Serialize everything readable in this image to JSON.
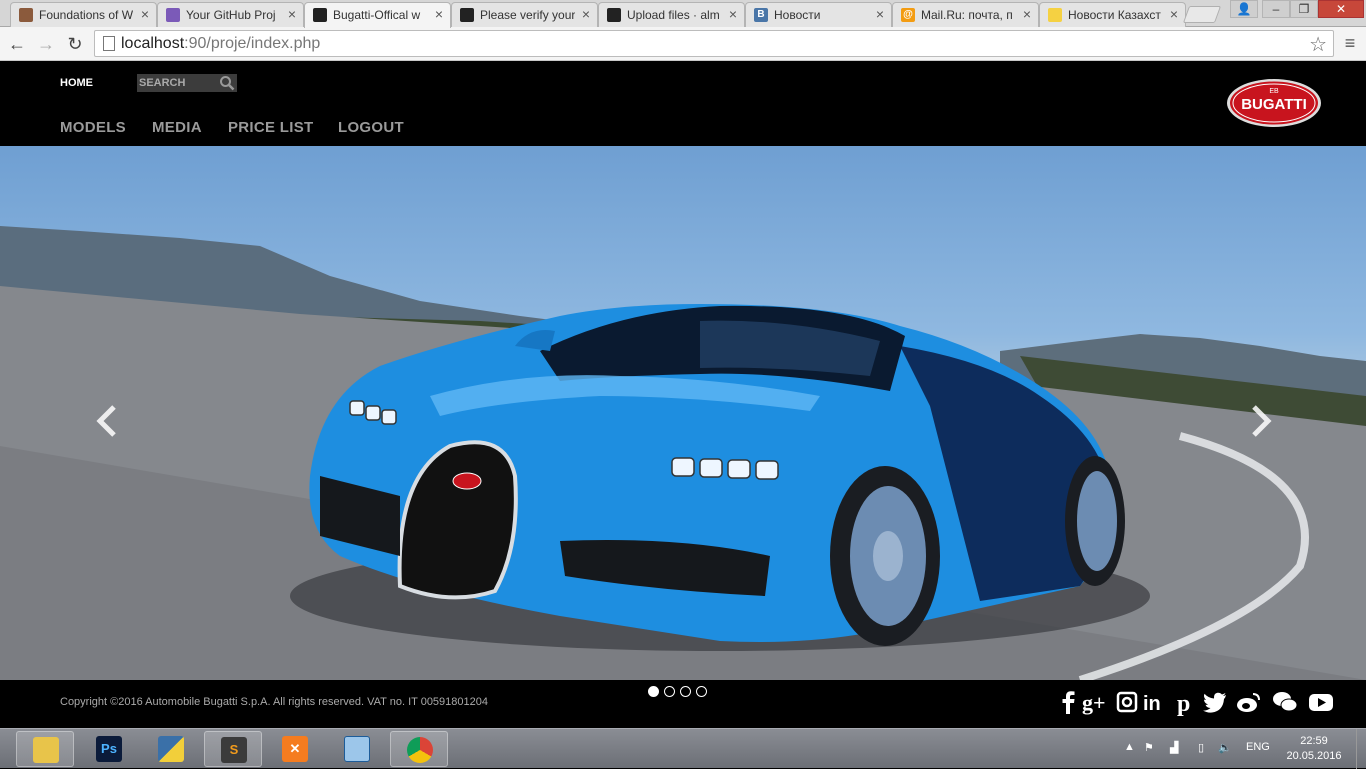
{
  "browser": {
    "tabs": [
      {
        "title": "Foundations of W",
        "favicon_color": "#8b5a3c",
        "favicon_char": "",
        "active": false
      },
      {
        "title": "Your GitHub Proj",
        "favicon_color": "#7b5ab8",
        "favicon_char": "",
        "active": false
      },
      {
        "title": "Bugatti-Offical w",
        "favicon_color": "#222222",
        "favicon_char": "",
        "active": true
      },
      {
        "title": "Please verify your",
        "favicon_color": "#222222",
        "favicon_char": "",
        "active": false
      },
      {
        "title": "Upload files · alm",
        "favicon_color": "#222222",
        "favicon_char": "",
        "active": false
      },
      {
        "title": "Новости",
        "favicon_color": "#4a76a8",
        "favicon_char": "В",
        "active": false
      },
      {
        "title": "Mail.Ru: почта, п",
        "favicon_color": "#f39c12",
        "favicon_char": "@",
        "active": false
      },
      {
        "title": "Новости Казахст",
        "favicon_color": "#f5d142",
        "favicon_char": "",
        "active": false
      }
    ],
    "url_host": "localhost",
    "url_path": ":90/proje/index.php"
  },
  "site": {
    "nav_home": "HOME",
    "search_placeholder": "SEARCH",
    "main_nav": [
      "MODELS",
      "MEDIA",
      "PRICE LIST",
      "LOGOUT"
    ],
    "logo_text": "BUGATTI",
    "copyright": "Copyright ©2016 Automobile Bugatti S.p.A. All rights reserved. VAT no. IT 00591801204",
    "slider_dots": 4,
    "active_slide": 1,
    "social": [
      "facebook-icon",
      "google-plus-icon",
      "instagram-icon",
      "linkedin-icon",
      "pinterest-icon",
      "twitter-icon",
      "weibo-icon",
      "wechat-icon",
      "youtube-icon"
    ]
  },
  "taskbar": {
    "apps": [
      "file-explorer-icon",
      "photoshop-icon",
      "python-icon",
      "sublime-text-icon",
      "xampp-icon",
      "virtualbox-icon",
      "chrome-icon"
    ],
    "language": "ENG",
    "time": "22:59",
    "date": "20.05.2016"
  },
  "colors": {
    "hero_car": "#1e8ee0",
    "logo_red": "#c8141e"
  }
}
